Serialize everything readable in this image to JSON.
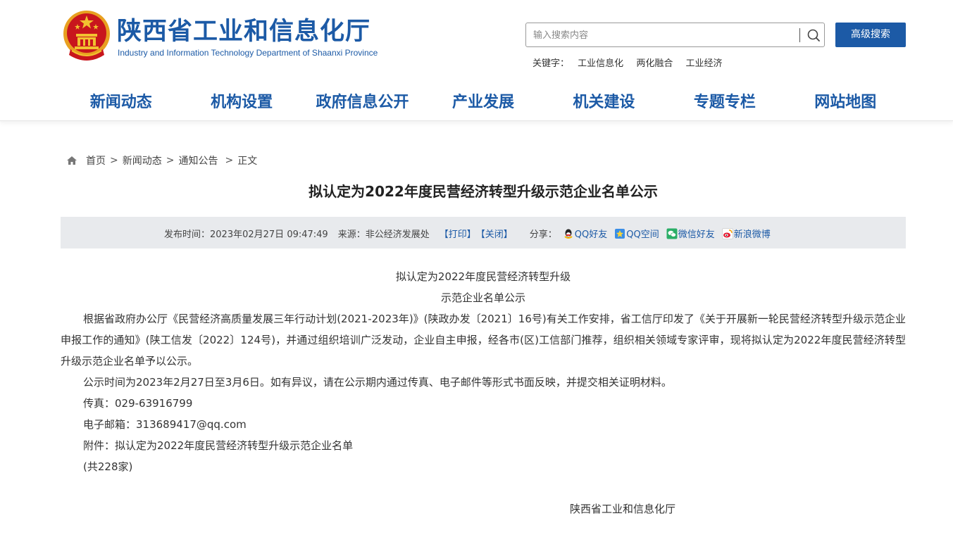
{
  "header": {
    "title_cn": "陕西省工业和信息化厅",
    "title_en": "Industry and Information Technology Department of Shaanxi Province"
  },
  "search": {
    "placeholder": "输入搜索内容",
    "advanced_label": "高级搜索",
    "keywords_label": "关键字：",
    "keywords": [
      "工业信息化",
      "两化融合",
      "工业经济"
    ]
  },
  "nav": {
    "items": [
      "新闻动态",
      "机构设置",
      "政府信息公开",
      "产业发展",
      "机关建设",
      "专题专栏",
      "网站地图"
    ]
  },
  "breadcrumb": {
    "home": "首页",
    "news": "新闻动态",
    "notice": "通知公告",
    "current": "正文",
    "separator": ">"
  },
  "article": {
    "title": "拟认定为2022年度民营经济转型升级示范企业名单公示",
    "meta": {
      "publish_label": "发布时间：",
      "publish_time": "2023年02月27日 09:47:49",
      "source_label": "来源：",
      "source": "非公经济发展处",
      "print": "【打印】",
      "close": "【关闭】",
      "share_label": "分享：",
      "share": [
        "QQ好友",
        "QQ空间",
        "微信好友",
        "新浪微博"
      ]
    },
    "heading_line1": "拟认定为2022年度民营经济转型升级",
    "heading_line2": "示范企业名单公示",
    "paragraph1": "根据省政府办公厅《民营经济高质量发展三年行动计划(2021-2023年)》(陕政办发〔2021〕16号)有关工作安排，省工信厅印发了《关于开展新一轮民营经济转型升级示范企业申报工作的通知》(陕工信发〔2022〕124号)，并通过组织培训广泛发动，企业自主申报，经各市(区)工信部门推荐，组织相关领域专家评审，现将拟认定为2022年度民营经济转型升级示范企业名单予以公示。",
    "paragraph2": "公示时间为2023年2月27日至3月6日。如有异议，请在公示期内通过传真、电子邮件等形式书面反映，并提交相关证明材料。",
    "fax": "传真：029-63916799",
    "email": "电子邮箱：313689417@qq.com",
    "attachment": "附件：拟认定为2022年度民营经济转型升级示范企业名单",
    "count": "(共228家)",
    "signature": "陕西省工业和信息化厅"
  },
  "colors": {
    "brand_blue": "#1c5aa6",
    "meta_bar": "#e8eaed",
    "emblem_red": "#c8161d",
    "emblem_gold": "#f2c230"
  }
}
